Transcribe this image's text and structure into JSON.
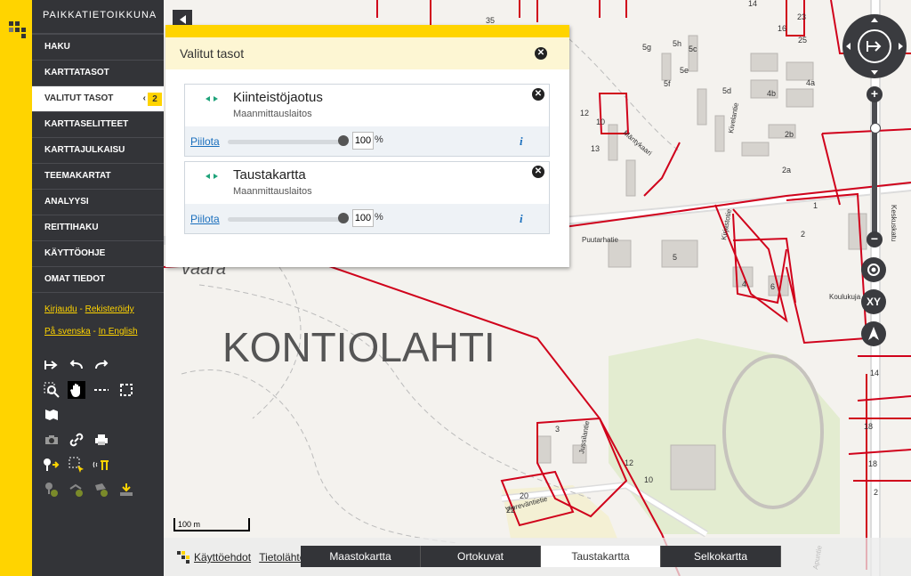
{
  "app": {
    "title": "PAIKKATIETOIKKUNA"
  },
  "nav": {
    "items": [
      {
        "label": "HAKU"
      },
      {
        "label": "KARTTATASOT"
      },
      {
        "label": "VALITUT TASOT",
        "badge": "2"
      },
      {
        "label": "KARTTASELITTEET"
      },
      {
        "label": "KARTTAJULKAISU"
      },
      {
        "label": "TEEMAKARTAT"
      },
      {
        "label": "ANALYYSI"
      },
      {
        "label": "REITTIHAKU"
      },
      {
        "label": "KÄYTTÖOHJE"
      },
      {
        "label": "OMAT TIEDOT"
      }
    ],
    "login": "Kirjaudu",
    "register": "Rekisteröidy",
    "lang_sv": "På svenska",
    "lang_en": "In English",
    "sep": "-"
  },
  "panel": {
    "title": "Valitut tasot",
    "layers": [
      {
        "name": "Kiinteistöjaotus",
        "source": "Maanmittauslaitos",
        "hide_label": "Piilota",
        "opacity": "100",
        "unit": "%",
        "info": "i"
      },
      {
        "name": "Taustakartta",
        "source": "Maanmittauslaitos",
        "hide_label": "Piilota",
        "opacity": "100",
        "unit": "%",
        "info": "i"
      }
    ]
  },
  "map": {
    "place_label": "KONTIOLAHTI",
    "area_label": "vaara",
    "scale_label": "100 m",
    "street_labels": [
      "Puutarhatie",
      "Keskuskatu",
      "Koulukuja",
      "Kivelantie",
      "Mäntykaari",
      "Kirjastotie",
      "Viereväntietie",
      "Jussilantie",
      "Apuntie"
    ],
    "parcel_numbers": [
      "23",
      "25",
      "14",
      "16",
      "35",
      "5g",
      "5h",
      "5c",
      "5e",
      "5f",
      "5d",
      "4b",
      "4a",
      "2b",
      "2a",
      "12",
      "10",
      "13",
      "5",
      "6",
      "4",
      "2",
      "1",
      "3",
      "11",
      "9",
      "18",
      "20",
      "22",
      "14",
      "12",
      "14",
      "18",
      "2"
    ],
    "zoom_in": "+",
    "zoom_out": "−",
    "xy_label": "XY",
    "north_label": "N"
  },
  "footer": {
    "terms": "Käyttöehdot",
    "datasets": "Tietolähteet"
  },
  "basemaps": {
    "tabs": [
      "Maastokartta",
      "Ortokuvat",
      "Taustakartta",
      "Selkokartta"
    ],
    "selected": "Taustakartta"
  },
  "colors": {
    "accent": "#ffd400",
    "sidebar": "#333438",
    "parcel_line": "#d0021b",
    "link": "#1a6fbd"
  }
}
